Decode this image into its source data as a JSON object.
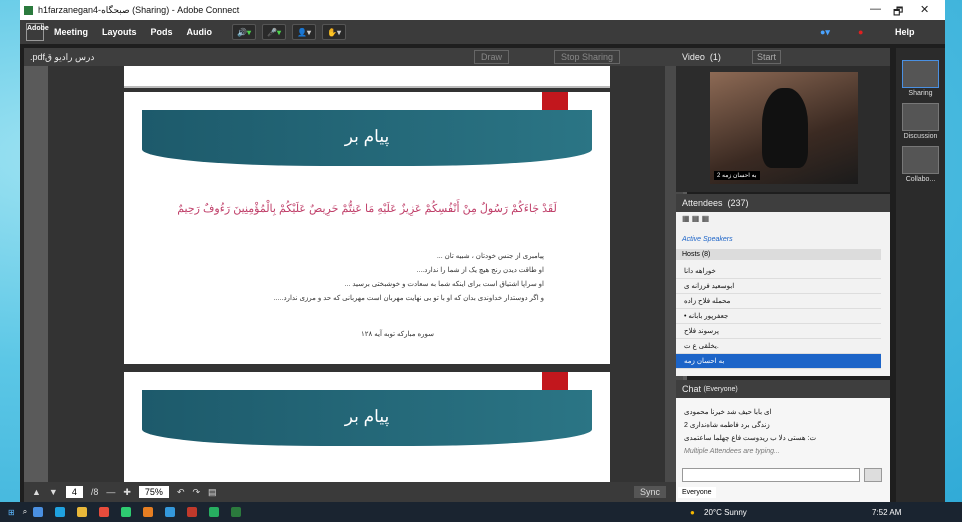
{
  "window": {
    "title": "h1farzanegan4-صبحگاه (Sharing) - Adobe Connect",
    "min": "—",
    "restore": "🗗",
    "close": "✕"
  },
  "menubar": {
    "logo": "Adobe",
    "items": [
      "Meeting",
      "Layouts",
      "Pods",
      "Audio"
    ],
    "help": "Help"
  },
  "share": {
    "title": ".pdfدرس رادیو ق",
    "draw": "Draw",
    "stop": "Stop Sharing"
  },
  "slides": [
    {
      "title": "پیام بر",
      "verse": "لَقَدْ جَاءَکُمْ رَسُولٌ مِنْ أَنْفُسِکُمْ عَزِیزٌ عَلَیْهِ مَا عَنِتُّمْ حَرِیصٌ عَلَیْکُمْ بِالْمُؤْمِنِینَ رَءُوفٌ رَحِیمٌ",
      "lines": [
        "پیامبری از جنس خودتان ، شبیه تان ...",
        "او طاقت دیدن رنج هیچ یک از شما را ندارد....",
        "او سراپا اشتیاق است برای اینکه شما به سعادت و خوشبختی برسید ...",
        "و اگر دوستدار خداوندی بدان که او با تو بی نهایت مهربان است مهربانی که حد و مرزی ندارد....."
      ],
      "ref": "سوره مبارکه توبه آیه ۱۲۸"
    },
    {
      "title": "پیام بر"
    }
  ],
  "bottom": {
    "page": "4",
    "total": "/8",
    "zoom": "75%",
    "sync": "Sync"
  },
  "video": {
    "title": "Video",
    "count": "(1)",
    "start": "Start",
    "caption": "2 به احسان زمه"
  },
  "attendees": {
    "title": "Attendees",
    "count": "(237)",
    "active": "Active Speakers",
    "hosts": "Hosts (8)",
    "rows": [
      "خوراهه دانا",
      "ابوسعید فرزانه ی",
      "محمله فلاح زاده",
      "• جعفرپور بابانه",
      "پرسوند فلاح",
      "یخلقی ع ت.",
      "به احسان زمه"
    ]
  },
  "chat": {
    "title": "Chat",
    "scope": "(Everyone)",
    "msgs": [
      "ای بابا حیف شد خیرنا محمودی",
      "2 زندگی برد فاطمه شاه‌نداری",
      "ت: هستی دلا ب ریدوست فاع چهلما ساعتمدی"
    ],
    "typing": "Multiple Attendees are typing...",
    "tab": "Everyone"
  },
  "layouts": [
    "Sharing",
    "Discussion",
    "Collabo..."
  ],
  "tray": {
    "weather": "20°C Sunny",
    "time": "7:52 AM"
  },
  "colors": {
    "accent": "#1c64c8",
    "ribbon": "#c2171d",
    "banner": "#1d5a6b"
  }
}
